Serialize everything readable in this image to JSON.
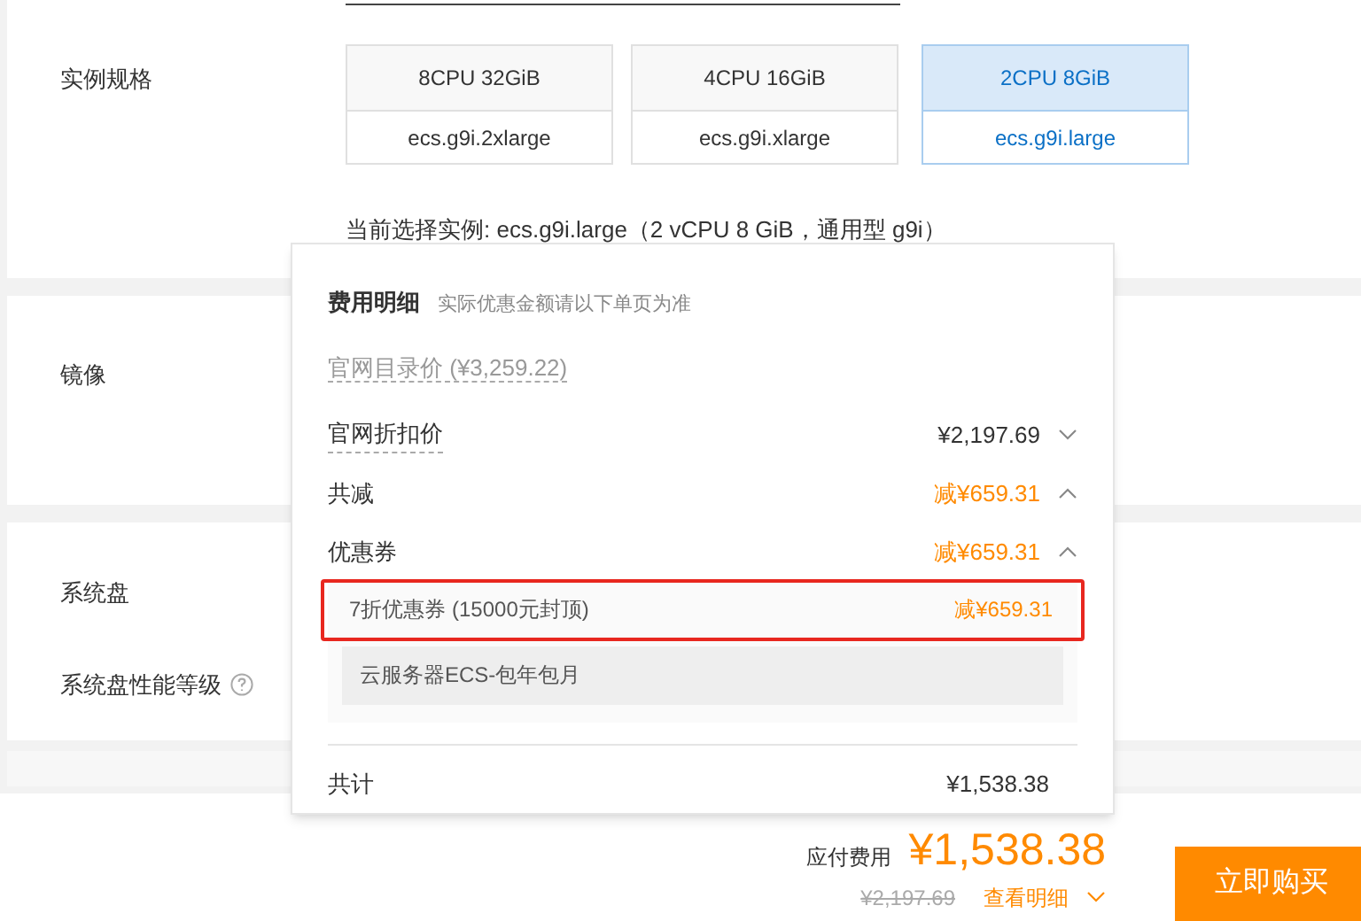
{
  "spec": {
    "label": "实例规格",
    "options": [
      {
        "cpu": "8CPU 32GiB",
        "type": "ecs.g9i.2xlarge",
        "selected": false
      },
      {
        "cpu": "4CPU 16GiB",
        "type": "ecs.g9i.xlarge",
        "selected": false
      },
      {
        "cpu": "2CPU 8GiB",
        "type": "ecs.g9i.large",
        "selected": true
      }
    ],
    "current": "当前选择实例: ecs.g9i.large（2 vCPU 8 GiB，通用型 g9i）"
  },
  "image": {
    "label": "镜像"
  },
  "system_disk": {
    "label": "系统盘",
    "performance_label": "系统盘性能等级"
  },
  "cost_popup": {
    "title": "费用明细",
    "note": "实际优惠金额请以下单页为准",
    "list_price": "官网目录价 (¥3,259.22)",
    "rows": [
      {
        "kind": "price",
        "label": "官网折扣价",
        "amount": "¥2,197.69",
        "expanded": false
      },
      {
        "kind": "discount",
        "label": "共减",
        "amount": "减¥659.31",
        "expanded": true
      },
      {
        "kind": "discount",
        "label": "优惠券",
        "amount": "减¥659.31",
        "expanded": true
      }
    ],
    "coupon": {
      "label": "7折优惠券 (15000元封顶)",
      "amount": "减¥659.31",
      "highlighted": true
    },
    "coupon_scope": "云服务器ECS-包年包月",
    "total": {
      "label": "共计",
      "amount": "¥1,538.38"
    }
  },
  "footer": {
    "label": "应付费用",
    "price": "¥1,538.38",
    "original_price": "¥2,197.69",
    "details_link": "查看明细",
    "buy_button": "立即购买"
  }
}
